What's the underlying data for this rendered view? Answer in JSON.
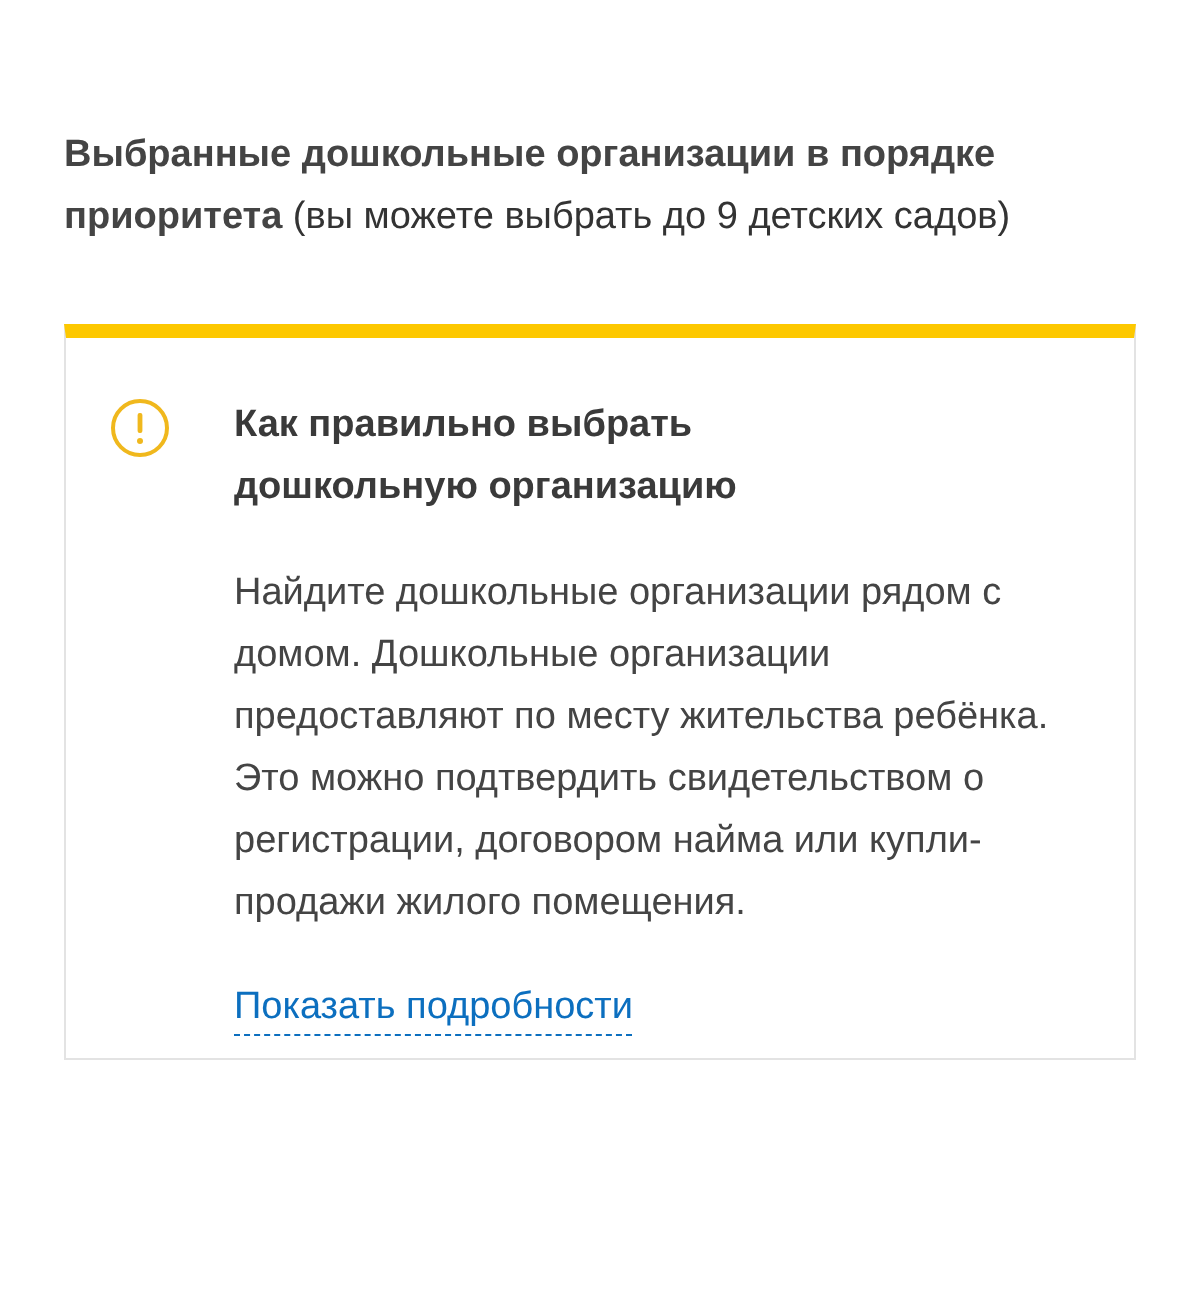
{
  "heading": "**Выбранные дошкольные организации в порядке приоритета** (вы можете выбрать до 9 детских садов)",
  "notice": {
    "title": "Как правильно выбрать дошкольную организацию",
    "text": "Найдите дошкольные организации рядом с домом. Дошкольные организации предоставляют по месту жительства ребёнка. Это можно подтвердить свидетельством о регистрации, договором найма или купли-продажи жилого помещения.",
    "link": "Показать подробности"
  }
}
